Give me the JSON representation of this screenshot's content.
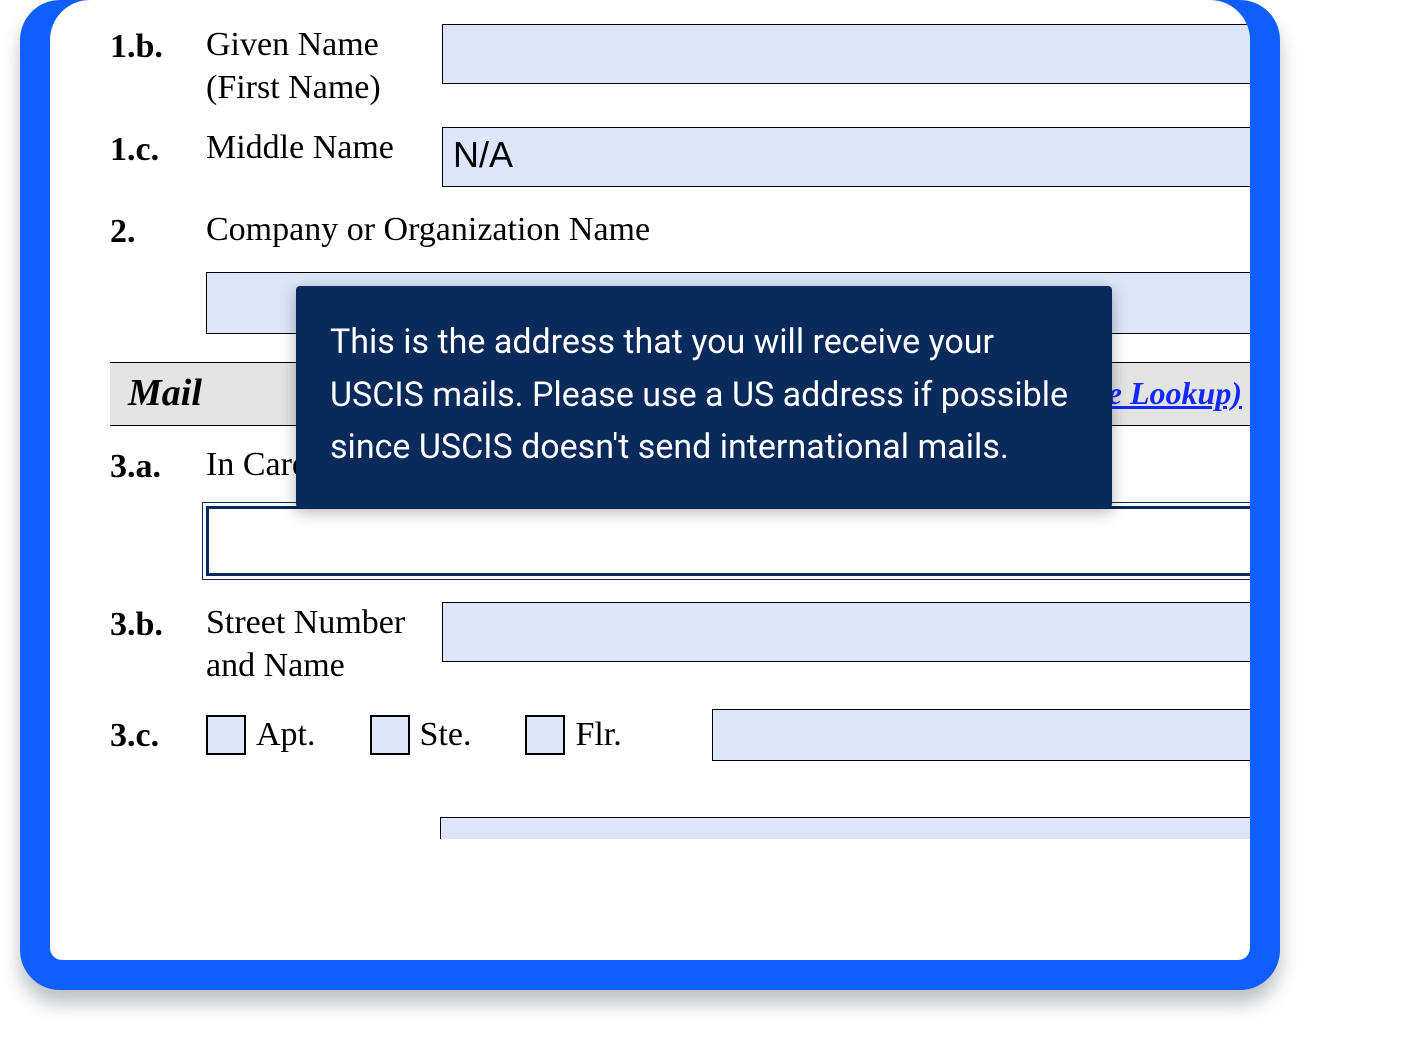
{
  "fields": {
    "f1b": {
      "num": "1.b.",
      "label": "Given Name (First Name)",
      "value": ""
    },
    "f1c": {
      "num": "1.c.",
      "label": "Middle Name",
      "value": "N/A"
    },
    "f2": {
      "num": "2.",
      "label": "Company or Organization Name",
      "value": ""
    }
  },
  "section": {
    "title_prefix": "Mail",
    "zip_link_text": "Code Lookup)"
  },
  "f3a": {
    "num": "3.a.",
    "label": "In Care Of Name",
    "value": ""
  },
  "f3b": {
    "num": "3.b.",
    "label": "Street Number and Name",
    "value": ""
  },
  "f3c": {
    "num": "3.c.",
    "options": {
      "apt": "Apt.",
      "ste": "Ste.",
      "flr": "Flr."
    },
    "value": ""
  },
  "tooltip": {
    "text": "This is the address that you will receive your USCIS mails. Please use a US address if possible since USCIS doesn't send international mails."
  }
}
